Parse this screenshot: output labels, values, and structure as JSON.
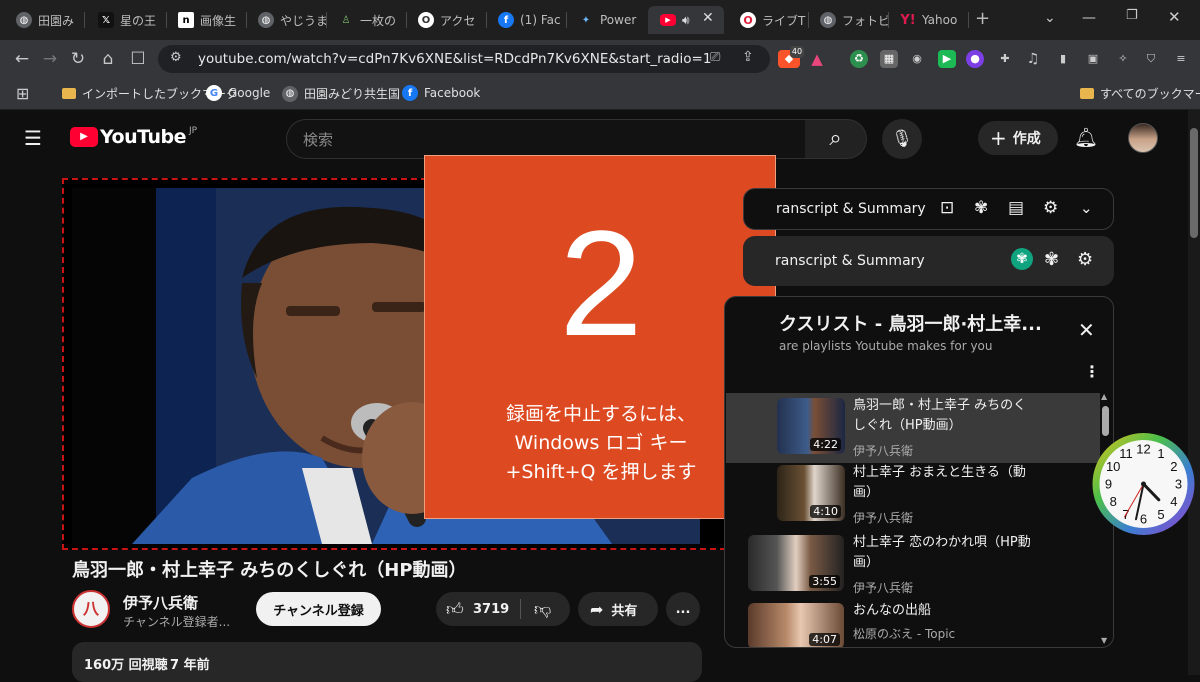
{
  "tabs": [
    {
      "label": "田園み",
      "icon": "globe-icon"
    },
    {
      "label": "星の王",
      "icon": "x-logo-icon"
    },
    {
      "label": "画像生",
      "icon": "notion-icon"
    },
    {
      "label": "やじうま",
      "icon": "globe-icon"
    },
    {
      "label": "一枚の",
      "icon": "bottle-icon"
    },
    {
      "label": "アクセ",
      "icon": "opera-icon"
    },
    {
      "label": "(1) Fac",
      "icon": "facebook-icon"
    },
    {
      "label": "Power",
      "icon": "butterfly-icon"
    },
    {
      "label": "",
      "icon": "youtube-icon"
    },
    {
      "label": "ライブT",
      "icon": "opera-red-icon"
    },
    {
      "label": "フォトビ",
      "icon": "globe-icon"
    },
    {
      "label": "Yahoo",
      "icon": "yahoo-icon"
    }
  ],
  "browser": {
    "url": "youtube.com/watch?v=cdPn7Kv6XNE&list=RDcdPn7Kv6XNE&start_radio=1",
    "brave_badge": "40",
    "new_tab": "+"
  },
  "bookmarks": [
    {
      "label": "インポートしたブックマーク",
      "icon": "folder-icon"
    },
    {
      "label": "Google",
      "icon": "google-icon"
    },
    {
      "label": "田園みどり共生国",
      "icon": "globe-icon"
    },
    {
      "label": "Facebook",
      "icon": "facebook-icon"
    }
  ],
  "all_bookmarks": "すべてのブックマーク",
  "youtube": {
    "logo_text": "YouTube",
    "region": "JP",
    "search_placeholder": "検索",
    "create_label": "作成"
  },
  "overlay": {
    "countdown": "2",
    "message_line1": "録画を中止するには、",
    "message_line2": "Windows ロゴ キー",
    "message_line3": "+Shift+Q を押します"
  },
  "video": {
    "title": "鳥羽一郎・村上幸子 みちのくしぐれ（HP動画）",
    "channel_name": "伊予八兵衛",
    "channel_sub": "チャンネル登録者...",
    "avatar_text": "八",
    "subscribe_label": "チャンネル登録",
    "likes": "3719",
    "share_label": "共有",
    "more_label": "...",
    "views": "160万 回視聴",
    "age": "7 年前"
  },
  "sidepanels": [
    {
      "label": "ranscript & Summary"
    },
    {
      "label": "ranscript & Summary"
    }
  ],
  "playlist": {
    "title": "クスリスト - 鳥羽一郎·村上幸...",
    "subtitle": "are playlists Youtube makes for you",
    "items": [
      {
        "title_line1": "鳥羽一郎・村上幸子 みちのく",
        "title_line2": "しぐれ（HP動画）",
        "channel": "伊予八兵衛",
        "duration": "4:22"
      },
      {
        "title_line1": "村上幸子 おまえと生きる（動",
        "title_line2": "画）",
        "channel": "伊予八兵衛",
        "duration": "4:10"
      },
      {
        "title_line1": "村上幸子 恋のわかれ唄（HP動",
        "title_line2": "画）",
        "channel": "伊予八兵衛",
        "duration": "3:55"
      },
      {
        "title_line1": "おんなの出船",
        "title_line2": "",
        "channel": "松原のぶえ - Topic",
        "duration": "4:07"
      }
    ]
  },
  "clock": {
    "numbers": [
      "12",
      "1",
      "2",
      "3",
      "4",
      "5",
      "6",
      "7",
      "8",
      "9",
      "10",
      "11"
    ],
    "brand": "",
    "hour": 4,
    "minute": 32,
    "second": 35
  }
}
